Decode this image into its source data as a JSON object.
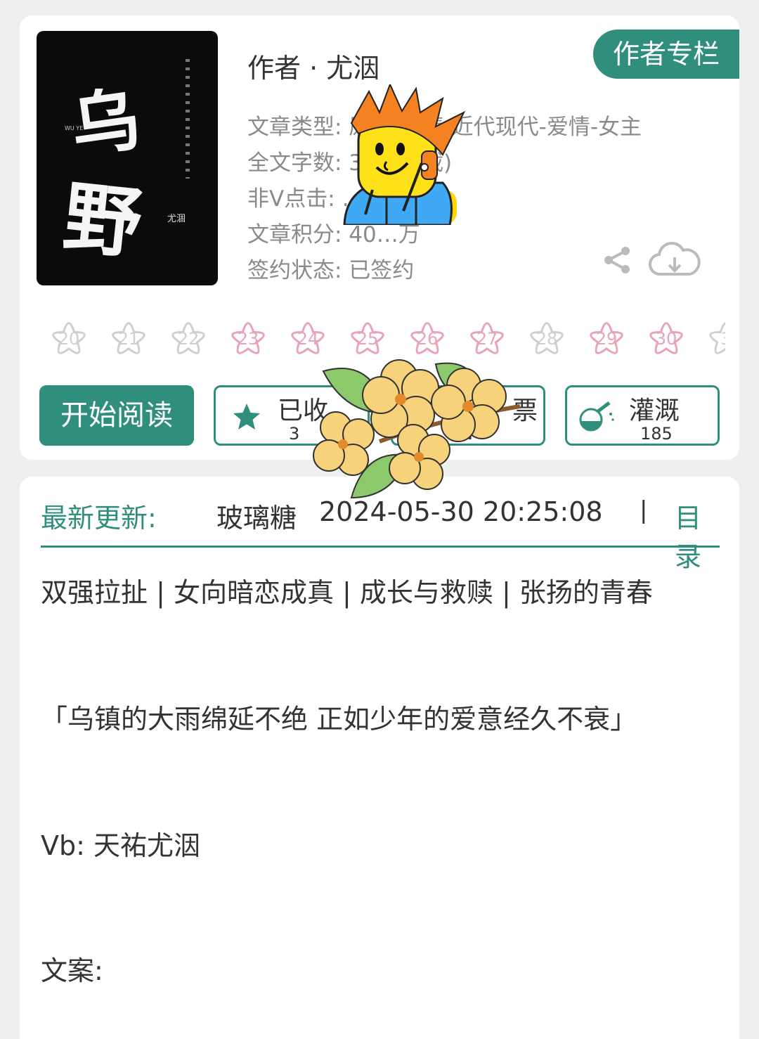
{
  "book": {
    "cover_title_1": "乌",
    "cover_title_2": "野",
    "cover_pinyin": "WU YE",
    "cover_author": "尤涸",
    "author_line": "作者 · 尤洇",
    "author_column_button": "作者专栏",
    "meta": [
      "文章类型: 原创-言情-近代现代-爱情-女主",
      "全文字数: 3… (连载)",
      "非V点击: …)",
      "文章积分: 40…万",
      "签约状态: 已签约"
    ]
  },
  "flowers": [
    {
      "label": "20",
      "color": "#cfcfcf"
    },
    {
      "label": "21",
      "color": "#cfcfcf"
    },
    {
      "label": "22",
      "color": "#cfcfcf"
    },
    {
      "label": "23",
      "color": "#e9a3b4"
    },
    {
      "label": "24",
      "color": "#e9a3b4"
    },
    {
      "label": "25",
      "color": "#e9a3b4"
    },
    {
      "label": "26",
      "color": "#e9a3b4"
    },
    {
      "label": "27",
      "color": "#e9a3b4"
    },
    {
      "label": "28",
      "color": "#cfcfcf"
    },
    {
      "label": "29",
      "color": "#e9a3b4"
    },
    {
      "label": "30",
      "color": "#e9a3b4"
    },
    {
      "label": "3",
      "color": "#cfcfcf"
    }
  ],
  "actions": {
    "read_label": "开始阅读",
    "favorite_label": "已收",
    "favorite_count": "3",
    "vote_label": "票",
    "vote_count": "N",
    "water_label": "灌溉",
    "water_count": "185"
  },
  "latest": {
    "label": "最新更新:",
    "chapter": "玻璃糖",
    "datetime": "2024-05-30 20:25:08",
    "separator": "|",
    "toc_link": "目录"
  },
  "content": {
    "tags": "双强拉扯 | 女向暗恋成真 | 成长与救赎 | 张扬的青春",
    "quote": "「乌镇的大雨绵延不绝 正如少年的爱意经久不衰」",
    "weibo": "Vb: 天祐尤洇",
    "synopsis_label": "文案:"
  },
  "colors": {
    "accent": "#2f8f7c",
    "pink_flower": "#e9a3b4",
    "grey_flower": "#cfcfcf"
  }
}
